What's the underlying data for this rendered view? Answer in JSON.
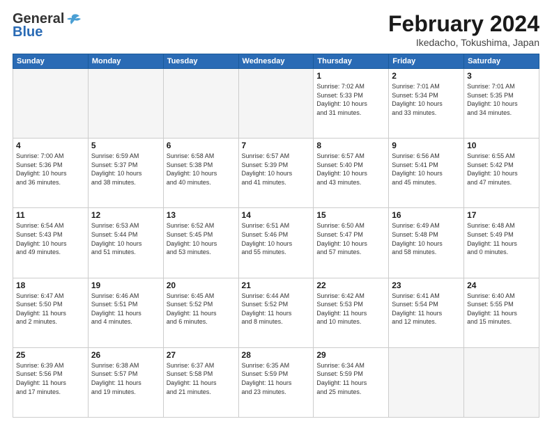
{
  "header": {
    "logo_general": "General",
    "logo_blue": "Blue",
    "month_title": "February 2024",
    "location": "Ikedacho, Tokushima, Japan"
  },
  "days_of_week": [
    "Sunday",
    "Monday",
    "Tuesday",
    "Wednesday",
    "Thursday",
    "Friday",
    "Saturday"
  ],
  "weeks": [
    [
      {
        "day": "",
        "info": ""
      },
      {
        "day": "",
        "info": ""
      },
      {
        "day": "",
        "info": ""
      },
      {
        "day": "",
        "info": ""
      },
      {
        "day": "1",
        "info": "Sunrise: 7:02 AM\nSunset: 5:33 PM\nDaylight: 10 hours\nand 31 minutes."
      },
      {
        "day": "2",
        "info": "Sunrise: 7:01 AM\nSunset: 5:34 PM\nDaylight: 10 hours\nand 33 minutes."
      },
      {
        "day": "3",
        "info": "Sunrise: 7:01 AM\nSunset: 5:35 PM\nDaylight: 10 hours\nand 34 minutes."
      }
    ],
    [
      {
        "day": "4",
        "info": "Sunrise: 7:00 AM\nSunset: 5:36 PM\nDaylight: 10 hours\nand 36 minutes."
      },
      {
        "day": "5",
        "info": "Sunrise: 6:59 AM\nSunset: 5:37 PM\nDaylight: 10 hours\nand 38 minutes."
      },
      {
        "day": "6",
        "info": "Sunrise: 6:58 AM\nSunset: 5:38 PM\nDaylight: 10 hours\nand 40 minutes."
      },
      {
        "day": "7",
        "info": "Sunrise: 6:57 AM\nSunset: 5:39 PM\nDaylight: 10 hours\nand 41 minutes."
      },
      {
        "day": "8",
        "info": "Sunrise: 6:57 AM\nSunset: 5:40 PM\nDaylight: 10 hours\nand 43 minutes."
      },
      {
        "day": "9",
        "info": "Sunrise: 6:56 AM\nSunset: 5:41 PM\nDaylight: 10 hours\nand 45 minutes."
      },
      {
        "day": "10",
        "info": "Sunrise: 6:55 AM\nSunset: 5:42 PM\nDaylight: 10 hours\nand 47 minutes."
      }
    ],
    [
      {
        "day": "11",
        "info": "Sunrise: 6:54 AM\nSunset: 5:43 PM\nDaylight: 10 hours\nand 49 minutes."
      },
      {
        "day": "12",
        "info": "Sunrise: 6:53 AM\nSunset: 5:44 PM\nDaylight: 10 hours\nand 51 minutes."
      },
      {
        "day": "13",
        "info": "Sunrise: 6:52 AM\nSunset: 5:45 PM\nDaylight: 10 hours\nand 53 minutes."
      },
      {
        "day": "14",
        "info": "Sunrise: 6:51 AM\nSunset: 5:46 PM\nDaylight: 10 hours\nand 55 minutes."
      },
      {
        "day": "15",
        "info": "Sunrise: 6:50 AM\nSunset: 5:47 PM\nDaylight: 10 hours\nand 57 minutes."
      },
      {
        "day": "16",
        "info": "Sunrise: 6:49 AM\nSunset: 5:48 PM\nDaylight: 10 hours\nand 58 minutes."
      },
      {
        "day": "17",
        "info": "Sunrise: 6:48 AM\nSunset: 5:49 PM\nDaylight: 11 hours\nand 0 minutes."
      }
    ],
    [
      {
        "day": "18",
        "info": "Sunrise: 6:47 AM\nSunset: 5:50 PM\nDaylight: 11 hours\nand 2 minutes."
      },
      {
        "day": "19",
        "info": "Sunrise: 6:46 AM\nSunset: 5:51 PM\nDaylight: 11 hours\nand 4 minutes."
      },
      {
        "day": "20",
        "info": "Sunrise: 6:45 AM\nSunset: 5:52 PM\nDaylight: 11 hours\nand 6 minutes."
      },
      {
        "day": "21",
        "info": "Sunrise: 6:44 AM\nSunset: 5:52 PM\nDaylight: 11 hours\nand 8 minutes."
      },
      {
        "day": "22",
        "info": "Sunrise: 6:42 AM\nSunset: 5:53 PM\nDaylight: 11 hours\nand 10 minutes."
      },
      {
        "day": "23",
        "info": "Sunrise: 6:41 AM\nSunset: 5:54 PM\nDaylight: 11 hours\nand 12 minutes."
      },
      {
        "day": "24",
        "info": "Sunrise: 6:40 AM\nSunset: 5:55 PM\nDaylight: 11 hours\nand 15 minutes."
      }
    ],
    [
      {
        "day": "25",
        "info": "Sunrise: 6:39 AM\nSunset: 5:56 PM\nDaylight: 11 hours\nand 17 minutes."
      },
      {
        "day": "26",
        "info": "Sunrise: 6:38 AM\nSunset: 5:57 PM\nDaylight: 11 hours\nand 19 minutes."
      },
      {
        "day": "27",
        "info": "Sunrise: 6:37 AM\nSunset: 5:58 PM\nDaylight: 11 hours\nand 21 minutes."
      },
      {
        "day": "28",
        "info": "Sunrise: 6:35 AM\nSunset: 5:59 PM\nDaylight: 11 hours\nand 23 minutes."
      },
      {
        "day": "29",
        "info": "Sunrise: 6:34 AM\nSunset: 5:59 PM\nDaylight: 11 hours\nand 25 minutes."
      },
      {
        "day": "",
        "info": ""
      },
      {
        "day": "",
        "info": ""
      }
    ]
  ]
}
